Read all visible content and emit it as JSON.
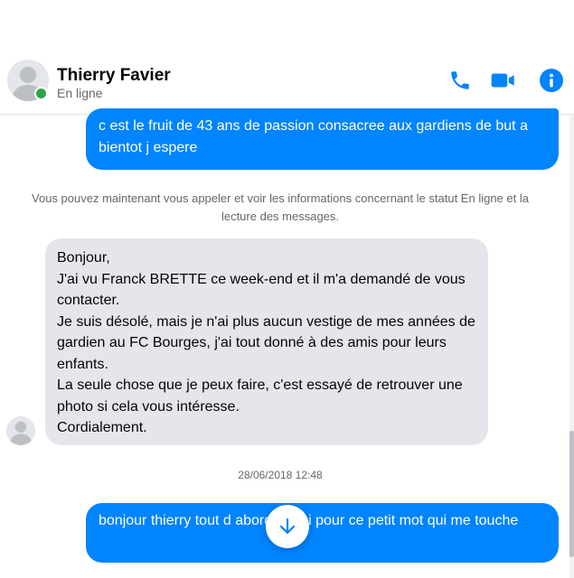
{
  "contact": {
    "name": "Thierry Favier",
    "status": "En ligne"
  },
  "header_icons": [
    "phone-icon",
    "video-camera-icon",
    "info-icon"
  ],
  "colors": {
    "accent": "#0084ff",
    "incoming_bubble": "#e4e6eb",
    "online": "#31a24c",
    "muted_text": "#65676b"
  },
  "messages": {
    "outgoing_1": "c est le fruit de 43 ans de passion consacree aux gardiens de but  a bientot j espere",
    "notice": "Vous pouvez maintenant vous appeler et voir les informations concernant le statut En ligne et la lecture des messages.",
    "incoming_1": "Bonjour,\nJ'ai vu Franck BRETTE ce week-end et il m'a demandé de vous contacter.\nJe suis désolé, mais je n'ai plus aucun vestige de mes années de gardien au FC Bourges, j'ai tout donné à des amis pour leurs enfants.\nLa seule chose que je peux faire, c'est essayé de retrouver une photo si cela vous intéresse.\nCordialement.",
    "timestamp": "28/06/2018 12:48",
    "outgoing_2": "bonjour thierry tout d abord merci pour ce petit mot qui me touche"
  }
}
